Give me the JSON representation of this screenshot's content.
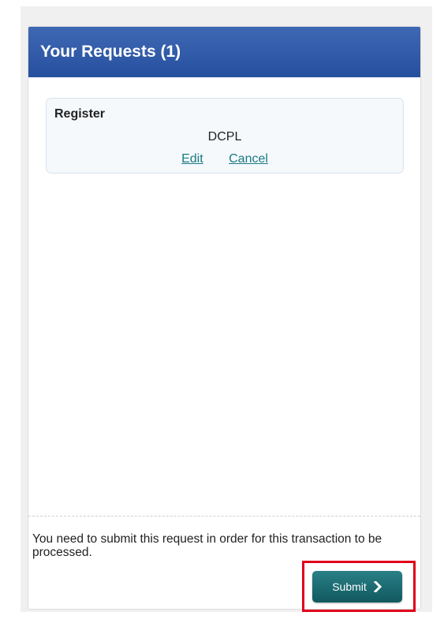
{
  "panel": {
    "title": "Your Requests (1)"
  },
  "request": {
    "type": "Register",
    "item": "DCPL",
    "edit_label": "Edit",
    "cancel_label": "Cancel"
  },
  "footer": {
    "notice": "You need to submit this request in order for this transaction to be processed.",
    "submit_label": "Submit",
    "submit_icon": "chevron-right-icon"
  },
  "colors": {
    "header": "#2f5aa8",
    "link": "#1a7a82",
    "submit": "#1a6c72",
    "highlight": "#e0001b"
  }
}
